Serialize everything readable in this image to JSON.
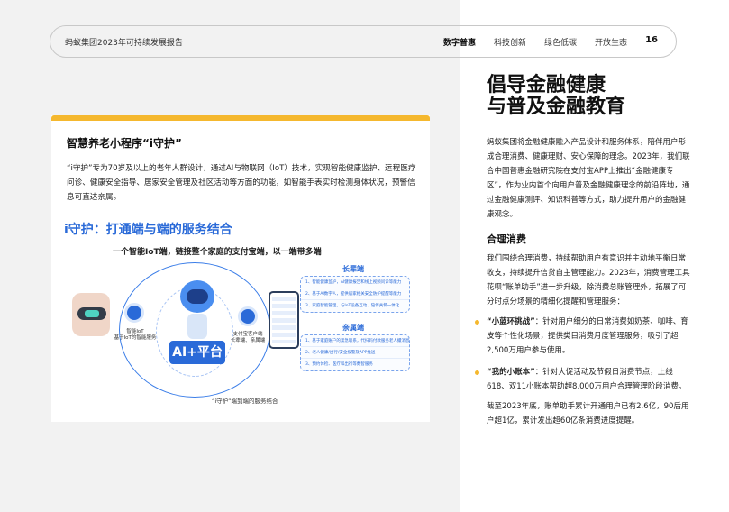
{
  "header": {
    "report_title": "蚂蚁集团2023年可持续发展报告",
    "nav": [
      "数字普惠",
      "科技创新",
      "绿色低碳",
      "开放生态"
    ],
    "page_number": "16"
  },
  "card": {
    "title": "智慧养老小程序“i守护”",
    "paragraph": "“i守护”专为70岁及以上的老年人群设计，通过AI与物联网（IoT）技术，实现智能健康监护、远程医疗问诊、健康安全指导、居家安全管理及社区活动等方面的功能，如智能手表实时检测身体状况，预警信息可直达亲属。",
    "diagram": {
      "title": "i守护：打通端与端的服务结合",
      "subtitle": "一个智能IoT端，链接整个家庭的支付宝端，以一端带多端",
      "left_node_label": "智能IoT\n基于IoT的智能服务",
      "right_node_label": "支付宝客户端\n长辈端、亲属端",
      "center_label": "AI+平台",
      "elder_title": "长辈端",
      "elder_rows": [
        "1、智能健康监护，AI健康报告和线上视频问诊等能力",
        "2、基于AI数字人，提供居家相关安全防护提醒等能力",
        "3、家庭智能管理，与IoT设备互动、陪伴关怀一体化"
      ],
      "family_title": "亲属端",
      "family_rows": [
        "1、基于家庭账户的紧急联系，代扫码付款服务老人撮消息",
        "2、老人健康/出行/安全报警及APP推送",
        "3、预约体检、医疗和出行等数智服务"
      ],
      "caption": "“i守护”端到端的服务结合"
    }
  },
  "right": {
    "heading_line1": "倡导金融健康",
    "heading_line2": "与普及金融教育",
    "intro": "蚂蚁集团将金融健康融入产品设计和服务体系，陪伴用户形成合理消费、健康理财、安心保障的理念。2023年，我们联合中国普惠金融研究院在支付宝APP上推出“金融健康专区”，作为业内首个向用户普及金融健康理念的前沿阵地，通过金融健康测评、知识科普等方式，助力提升用户的金融健康观念。",
    "subheading": "合理消费",
    "consumption": "我们围绕合理消费，持续帮助用户有意识并主动地平衡日常收支，持续提升信贷自主管理能力。2023年，消费管理工具花呗“账单助手”进一步升级，除消费总账管理外，拓展了可分时点分场景的精细化提醒和管理服务：",
    "bullet1_bold": "“小蓝环挑战”",
    "bullet1_text": "：针对用户细分的日常消费如奶茶、咖啡、育皮等个性化场景，提供类目消费月度管理服务，吸引了超2,500万用户参与使用。",
    "bullet2_bold": "“我的小账本”",
    "bullet2_text": "：针对大促活动及节假日消费节点，上线618、双11小账本帮助超8,000万用户合理管理阶段消费。",
    "closing": "截至2023年底，账单助手累计开通用户已有2.6亿，90后用户超1亿，累计发出超60亿条消费进度提醒。"
  }
}
